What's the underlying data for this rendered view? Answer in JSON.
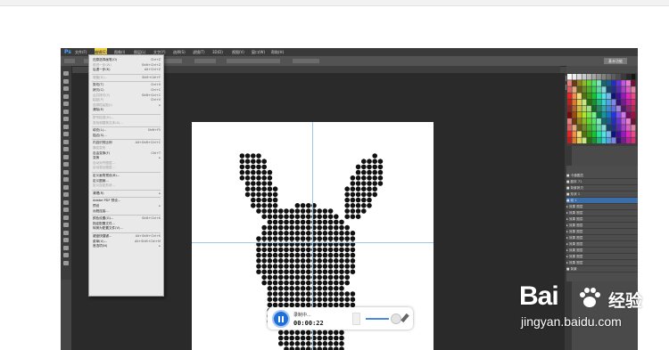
{
  "app": {
    "logo": "Ps",
    "menu": [
      "文件(F)",
      "编辑(E)",
      "图像(I)",
      "图层(L)",
      "文字(Y)",
      "选择(S)",
      "滤镜(T)",
      "3D(D)",
      "视图(V)",
      "窗口(W)",
      "帮助(H)"
    ],
    "active_menu": "编辑(E)",
    "workspace_button": "基本功能",
    "doc_tab": "未标题-1 @ 100% (RGB/8)"
  },
  "edit_menu": {
    "items": [
      {
        "label": "还原选择画笔(O)",
        "shortcut": "Ctrl+Z",
        "dim": false
      },
      {
        "label": "前进一步(W)",
        "shortcut": "Shift+Ctrl+Z",
        "dim": true
      },
      {
        "label": "后退一步(K)",
        "shortcut": "Alt+Ctrl+Z",
        "dim": false
      },
      {
        "sep": true
      },
      {
        "label": "渐隐(D)...",
        "shortcut": "Shift+Ctrl+F",
        "dim": true
      },
      {
        "sep": true
      },
      {
        "label": "剪切(T)",
        "shortcut": "Ctrl+X",
        "dim": false
      },
      {
        "label": "拷贝(C)",
        "shortcut": "Ctrl+C",
        "dim": false
      },
      {
        "label": "合并拷贝(Y)",
        "shortcut": "Shift+Ctrl+C",
        "dim": true
      },
      {
        "label": "粘贴(P)",
        "shortcut": "Ctrl+V",
        "dim": true
      },
      {
        "label": "选择性粘贴(I)",
        "shortcut": "▸",
        "dim": true
      },
      {
        "label": "清除(E)",
        "shortcut": "",
        "dim": false
      },
      {
        "sep": true
      },
      {
        "label": "拼写检查(H)...",
        "shortcut": "",
        "dim": true
      },
      {
        "label": "查找和替换文本(X)...",
        "shortcut": "",
        "dim": true
      },
      {
        "sep": true
      },
      {
        "label": "填充(L)...",
        "shortcut": "Shift+F5",
        "dim": false
      },
      {
        "label": "描边(S)...",
        "shortcut": "",
        "dim": false
      },
      {
        "sep": true
      },
      {
        "label": "内容识别比例",
        "shortcut": "Alt+Shift+Ctrl+C",
        "dim": false
      },
      {
        "label": "操控变形",
        "shortcut": "",
        "dim": true
      },
      {
        "label": "自由变换(F)",
        "shortcut": "Ctrl+T",
        "dim": false
      },
      {
        "label": "变换",
        "shortcut": "▸",
        "dim": false
      },
      {
        "label": "自动对齐图层...",
        "shortcut": "",
        "dim": true
      },
      {
        "label": "自动混合图层...",
        "shortcut": "",
        "dim": true
      },
      {
        "sep": true
      },
      {
        "label": "定义画笔预设(B)...",
        "shortcut": "",
        "dim": false
      },
      {
        "label": "定义图案...",
        "shortcut": "",
        "dim": false
      },
      {
        "label": "定义自定形状...",
        "shortcut": "",
        "dim": true
      },
      {
        "sep": true
      },
      {
        "label": "清理(R)",
        "shortcut": "▸",
        "dim": false
      },
      {
        "sep": true
      },
      {
        "label": "Adobe PDF 预设...",
        "shortcut": "",
        "dim": false
      },
      {
        "label": "预设",
        "shortcut": "▸",
        "dim": false
      },
      {
        "label": "远程连接...",
        "shortcut": "",
        "dim": false
      },
      {
        "sep": true
      },
      {
        "label": "颜色设置(G)...",
        "shortcut": "Shift+Ctrl+K",
        "dim": false
      },
      {
        "label": "指定配置文件...",
        "shortcut": "",
        "dim": false
      },
      {
        "label": "转换为配置文件(V)...",
        "shortcut": "",
        "dim": false
      },
      {
        "sep": true
      },
      {
        "label": "键盘快捷键...",
        "shortcut": "Alt+Shift+Ctrl+K",
        "dim": false
      },
      {
        "label": "菜单(U)...",
        "shortcut": "Alt+Shift+Ctrl+M",
        "dim": false
      },
      {
        "label": "首选项(N)",
        "shortcut": "▸",
        "dim": false
      }
    ]
  },
  "layers": [
    {
      "label": "■ 卡通图层",
      "sel": false
    },
    {
      "label": "■ 副本 71",
      "sel": false
    },
    {
      "label": "■ 背景拷贝",
      "sel": false
    },
    {
      "label": "■ 形状 1",
      "sel": false
    },
    {
      "label": "■ 组 1",
      "sel": true
    },
    {
      "label": "  ▸ 效果 图层",
      "sel": false
    },
    {
      "label": "  ▸ 效果 图层",
      "sel": false
    },
    {
      "label": "  ▸ 效果 图层",
      "sel": false
    },
    {
      "label": "  ▸ 效果 图层",
      "sel": false
    },
    {
      "label": "  ▸ 效果 图层",
      "sel": false
    },
    {
      "label": "  ▸ 效果 图层",
      "sel": false
    },
    {
      "label": "  ▸ 效果 图层",
      "sel": false
    },
    {
      "label": "  ▸ 效果 图层",
      "sel": false
    },
    {
      "label": "  ▸ 效果 图层",
      "sel": false
    },
    {
      "label": "  ▸ 效果 图层",
      "sel": false
    },
    {
      "label": "■ 背景",
      "sel": false
    }
  ],
  "recorder": {
    "label": "录制中...",
    "time": "00:00:22",
    "volume": 0.7
  },
  "watermark": {
    "brand": "Bai",
    "brand2": "经验",
    "url": "jingyan.baidu.com"
  },
  "colors": {
    "accent_blue": "#1f6fd8",
    "menu_highlight": "#f0d04a"
  }
}
